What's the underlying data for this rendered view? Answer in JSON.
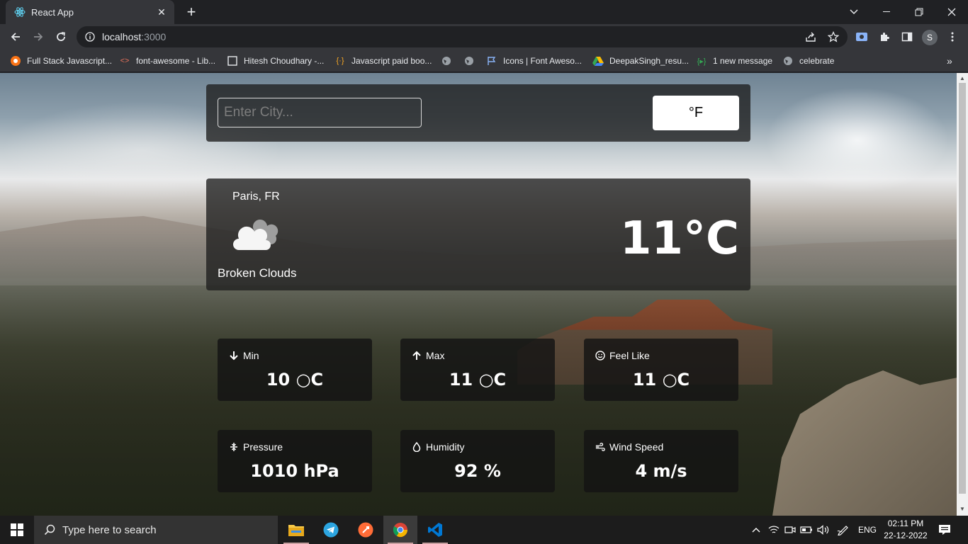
{
  "browser": {
    "tab_title": "React App",
    "url_host": "localhost",
    "url_port": ":3000",
    "profile_initial": "S",
    "bookmarks": [
      {
        "label": "Full Stack Javascript..."
      },
      {
        "label": "font-awesome - Lib..."
      },
      {
        "label": "Hitesh Choudhary -..."
      },
      {
        "label": "Javascript paid boo..."
      },
      {
        "label": ""
      },
      {
        "label": ""
      },
      {
        "label": "Icons | Font Aweso..."
      },
      {
        "label": "DeepakSingh_resu..."
      },
      {
        "label": "1 new message"
      },
      {
        "label": "celebrate"
      }
    ]
  },
  "weather": {
    "search_placeholder": "Enter City...",
    "unit_toggle_label": "°F",
    "city": "Paris, FR",
    "description": "Broken Clouds",
    "temperature": "11°C",
    "stats": [
      {
        "label": "Min",
        "value": "10 ○C",
        "icon": "arrow-down-icon"
      },
      {
        "label": "Max",
        "value": "11 ○C",
        "icon": "arrow-up-icon"
      },
      {
        "label": "Feel Like",
        "value": "11 ○C",
        "icon": "smile-icon"
      },
      {
        "label": "Pressure",
        "value": "1010 hPa",
        "icon": "pressure-icon"
      },
      {
        "label": "Humidity",
        "value": "92 %",
        "icon": "droplet-icon"
      },
      {
        "label": "Wind Speed",
        "value": "4 m/s",
        "icon": "wind-icon"
      }
    ]
  },
  "taskbar": {
    "search_placeholder": "Type here to search",
    "language": "ENG",
    "time": "02:11 PM",
    "date": "22-12-2022"
  },
  "colors": {
    "browser_bg": "#202124",
    "toolbar_bg": "#35363a",
    "panel_bg": "#1e1e1e",
    "taskbar_bg": "#1c1c1c"
  }
}
